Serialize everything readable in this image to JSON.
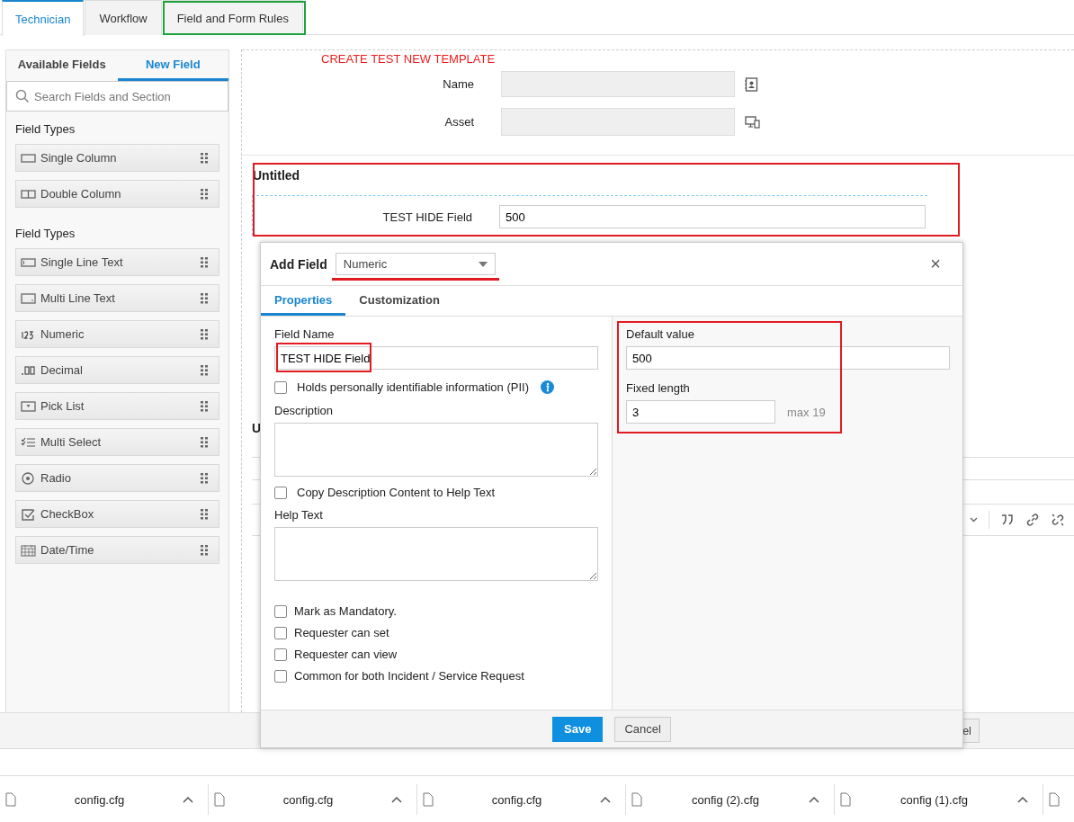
{
  "top_tabs": [
    {
      "label": "Technician",
      "selected": true,
      "highlighted": false
    },
    {
      "label": "Workflow",
      "selected": false,
      "highlighted": false
    },
    {
      "label": "Field and Form Rules",
      "selected": false,
      "highlighted": true
    }
  ],
  "left_panel": {
    "tabs": [
      {
        "label": "Available Fields",
        "selected": false
      },
      {
        "label": "New Field",
        "selected": true
      }
    ],
    "search": {
      "placeholder": "Search Fields and Section"
    },
    "groups": [
      {
        "heading": "Field Types",
        "items": [
          {
            "label": "Single Column",
            "kind": "singlecol"
          },
          {
            "label": "Double Column",
            "kind": "doublecol"
          }
        ]
      },
      {
        "heading": "Field Types",
        "items": [
          {
            "label": "Single Line Text",
            "kind": "singleline"
          },
          {
            "label": "Multi Line Text",
            "kind": "multiline"
          },
          {
            "label": "Numeric",
            "kind": "numeric"
          },
          {
            "label": "Decimal",
            "kind": "decimal"
          },
          {
            "label": "Pick List",
            "kind": "picklist"
          },
          {
            "label": "Multi Select",
            "kind": "multiselect"
          },
          {
            "label": "Radio",
            "kind": "radio"
          },
          {
            "label": "CheckBox",
            "kind": "checkbox"
          },
          {
            "label": "Date/Time",
            "kind": "datetime"
          }
        ]
      }
    ]
  },
  "template": {
    "title": "CREATE TEST NEW TEMPLATE",
    "fields": [
      {
        "label": "Name",
        "kind": "contact"
      },
      {
        "label": "Asset",
        "kind": "device"
      }
    ]
  },
  "section": {
    "title": "Untitled",
    "highlighted": true,
    "field": {
      "label": "TEST HIDE Field",
      "value": "500"
    }
  },
  "second_section": {
    "title": "U"
  },
  "footer_button": "el",
  "dialog": {
    "title": "Add Field",
    "type_select": {
      "value": "Numeric",
      "highlighted": true
    },
    "close": "×",
    "tabs": [
      {
        "label": "Properties",
        "selected": true
      },
      {
        "label": "Customization",
        "selected": false
      }
    ],
    "field_name": {
      "label": "Field Name",
      "value": "TEST HIDE Field",
      "highlighted": true
    },
    "pii": {
      "label": "Holds personally identifiable information (PII)",
      "checked": false
    },
    "description": {
      "label": "Description"
    },
    "copy_description": {
      "label": "Copy Description Content to Help Text",
      "checked": false
    },
    "help_text": {
      "label": "Help Text"
    },
    "options": [
      {
        "label": "Mark as Mandatory.",
        "checked": false
      },
      {
        "label": "Requester can set",
        "checked": false
      },
      {
        "label": "Requester can view",
        "checked": false
      },
      {
        "label": "Common for both Incident / Service Request",
        "checked": false
      }
    ],
    "right": {
      "highlighted": true,
      "default_value": {
        "label": "Default value",
        "value": "500"
      },
      "fixed_length": {
        "label": "Fixed length",
        "value": "3",
        "hint": "max 19"
      }
    },
    "buttons": [
      {
        "label": "Save",
        "kind": "primary"
      },
      {
        "label": "Cancel",
        "kind": "secondary"
      }
    ]
  },
  "downloads": [
    {
      "name": "config.cfg"
    },
    {
      "name": "config.cfg"
    },
    {
      "name": "config.cfg"
    },
    {
      "name": "config (2).cfg"
    },
    {
      "name": "config (1).cfg"
    }
  ]
}
